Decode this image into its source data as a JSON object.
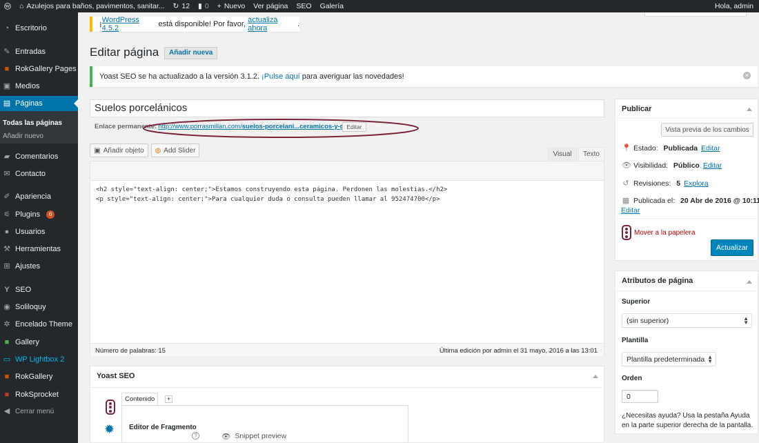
{
  "adminbar": {
    "site_name": "Azulejos para baños, pavimentos, sanitar...",
    "updates_count": "12",
    "comments_count": "0",
    "new_label": "Nuevo",
    "view_page": "Ver página",
    "seo": "SEO",
    "gallery": "Galería",
    "greeting": "Hola, admin"
  },
  "sidebar": {
    "items": [
      {
        "label": "Escritorio",
        "icon": "dashboard-icon"
      },
      {
        "label": "Entradas",
        "icon": "pin-icon"
      },
      {
        "label": "RokGallery Pages",
        "icon": "rokgallery-icon"
      },
      {
        "label": "Medios",
        "icon": "media-icon"
      },
      {
        "label": "Páginas",
        "icon": "pages-icon"
      },
      {
        "label": "Comentarios",
        "icon": "comment-icon"
      },
      {
        "label": "Contacto",
        "icon": "mail-icon"
      },
      {
        "label": "Apariencia",
        "icon": "brush-icon"
      },
      {
        "label": "Plugins",
        "icon": "plugin-icon",
        "badge": "6"
      },
      {
        "label": "Usuarios",
        "icon": "users-icon"
      },
      {
        "label": "Herramientas",
        "icon": "wrench-icon"
      },
      {
        "label": "Ajustes",
        "icon": "settings-icon"
      },
      {
        "label": "SEO",
        "icon": "yoast-icon"
      },
      {
        "label": "Soliloquy",
        "icon": "soliloquy-icon"
      },
      {
        "label": "Encelado Theme",
        "icon": "gear-icon"
      },
      {
        "label": "Gallery",
        "icon": "gallery-icon"
      },
      {
        "label": "WP Lightbox 2",
        "icon": "lightbox-icon"
      },
      {
        "label": "RokGallery",
        "icon": "rokgallery-icon"
      },
      {
        "label": "RokSprocket",
        "icon": "roksprocket-icon"
      },
      {
        "label": "Cerrar menú",
        "icon": "collapse-icon"
      }
    ],
    "submenu": {
      "all_pages": "Todas las páginas",
      "add_new": "Añadir nuevo"
    }
  },
  "notices": {
    "update_pre": "¡",
    "update_link": "WordPress 4.5.2",
    "update_mid": " está disponible! Por favor, ",
    "update_action": "actualiza ahora",
    "update_post": ".",
    "yoast_pre": "Yoast SEO se ha actualizado a la versión 3.1.2. ",
    "yoast_link": "¡Pulse aquí",
    "yoast_post": " para averiguar las novedades!"
  },
  "page": {
    "title": "Editar página",
    "add_new": "Añadir nueva",
    "post_title": "Suelos porcelánicos",
    "permalink_label": "Enlace permanente:",
    "permalink_base": "http://www.porrasmillan.com/",
    "permalink_slug": "suelos-porcelani...ceramicos-y-gres",
    "permalink_end": "/",
    "permalink_edit": "Editar"
  },
  "editor": {
    "add_media": "Añadir objeto",
    "add_slider": "Add Slider",
    "tab_visual": "Visual",
    "tab_text": "Texto",
    "code_line1": "<h2 style=\"text-align: center;\">Estamos construyendo esta página. Perdonen las molestias.</h2>",
    "code_line2": "<p style=\"text-align: center;\">Para cualquier duda o consulta pueden llamar al 952474700</p>",
    "word_count": "Número de palabras: 15",
    "last_edit": "Última edición por admin el 31 mayo, 2016 a las 13:01"
  },
  "yoast": {
    "title": "Yoast SEO",
    "tab_content": "Contenido",
    "tab_add": "+",
    "snippet_editor": "Editor de Fragmento",
    "help": "?",
    "snippet_preview": "Snippet preview"
  },
  "publish": {
    "title": "Publicar",
    "preview": "Vista previa de los cambios",
    "status_label": "Estado: ",
    "status_value": "Publicada",
    "visibility_label": "Visibilidad: ",
    "visibility_value": "Público",
    "revisions_label": "Revisiones: ",
    "revisions_value": "5",
    "revisions_link": "Explora",
    "published_label": "Publicada el: ",
    "published_value": "20 Abr de 2016 @ 10:11",
    "edit": "Editar",
    "trash": "Mover a la papelera",
    "update": "Actualizar"
  },
  "attributes": {
    "title": "Atributos de página",
    "parent_label": "Superior",
    "parent_value": "(sin superior)",
    "template_label": "Plantilla",
    "template_value": "Plantilla predeterminada",
    "order_label": "Orden",
    "order_value": "0",
    "help_text1": "¿Necesitas ayuda? Usa la pestaña Ayuda",
    "help_text2": "en la parte superior derecha de la pantalla."
  },
  "colors": {
    "accent": "#0073aa",
    "sidebar": "#23282d",
    "annotation": "#7a2437"
  }
}
